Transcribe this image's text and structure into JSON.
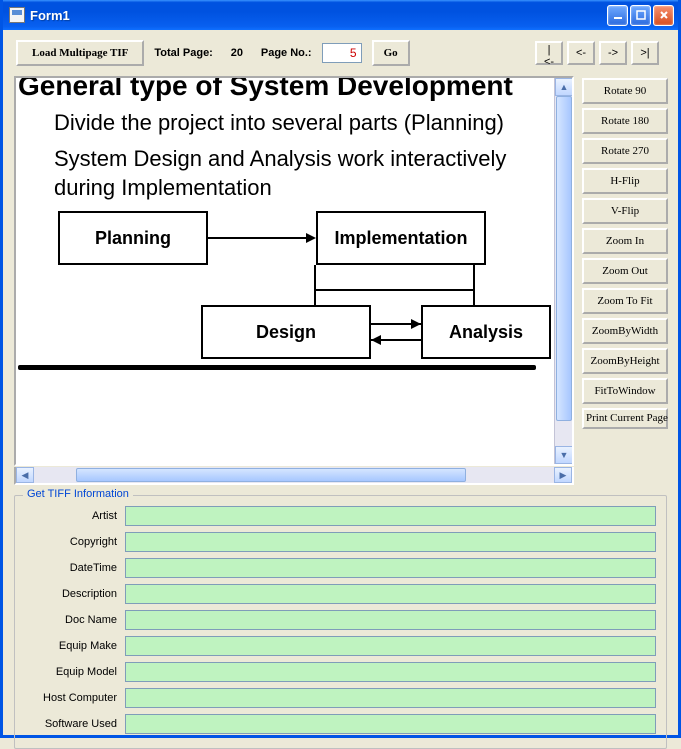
{
  "window": {
    "title": "Form1"
  },
  "toolbar": {
    "load_btn": "Load Multipage TIF",
    "total_label": "Total Page:",
    "total_value": "20",
    "pageno_label": "Page No.:",
    "pageno_value": "5",
    "go_btn": "Go",
    "nav_first": "|<-",
    "nav_prev": "<-",
    "nav_next": "->",
    "nav_last": ">|"
  },
  "document": {
    "heading": "General type of System Development",
    "bullet1": "Divide the project into several parts (Planning)",
    "bullet2": "System Design and Analysis work interactively during Implementation",
    "boxes": {
      "planning": "Planning",
      "implementation": "Implementation",
      "design": "Design",
      "analysis": "Analysis"
    }
  },
  "side_buttons": [
    "Rotate 90",
    "Rotate 180",
    "Rotate 270",
    "H-Flip",
    "V-Flip",
    "Zoom In",
    "Zoom Out",
    "Zoom To Fit",
    "ZoomByWidth",
    "ZoomByHeight",
    "FitToWindow",
    "Print Current Page"
  ],
  "tiff_group": {
    "legend": "Get TIFF Information",
    "rows": [
      {
        "label": "Artist",
        "value": ""
      },
      {
        "label": "Copyright",
        "value": ""
      },
      {
        "label": "DateTime",
        "value": ""
      },
      {
        "label": "Description",
        "value": ""
      },
      {
        "label": "Doc Name",
        "value": ""
      },
      {
        "label": "Equip Make",
        "value": ""
      },
      {
        "label": "Equip Model",
        "value": ""
      },
      {
        "label": "Host Computer",
        "value": ""
      },
      {
        "label": "Software Used",
        "value": ""
      }
    ]
  }
}
